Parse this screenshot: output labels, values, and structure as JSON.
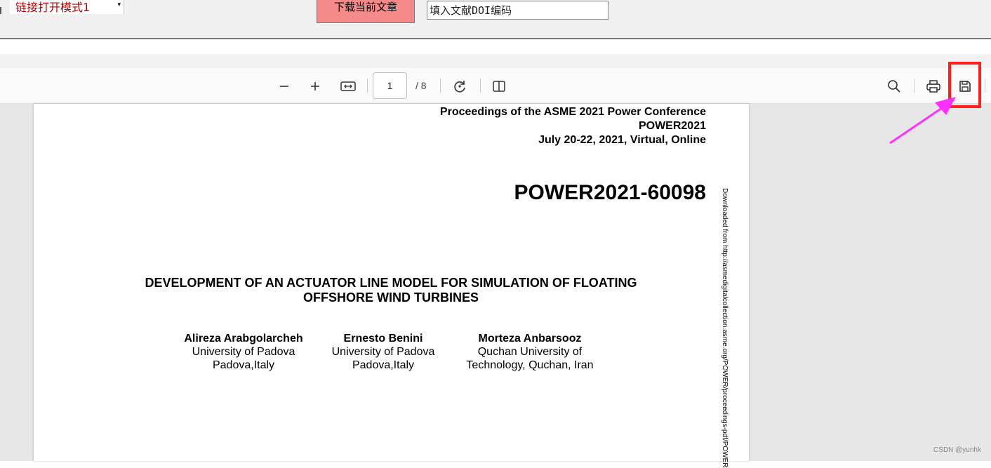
{
  "top_bar": {
    "mode_select_value": "链接打开模式1",
    "download_button_label": "下载当前文章",
    "doi_placeholder": "填入文献DOI编码"
  },
  "pdf_toolbar": {
    "page_current": "1",
    "page_total": "/ 8",
    "icons": [
      "zoom-out-icon",
      "zoom-in-icon",
      "fit-page-icon",
      "rotate-icon",
      "two-page-icon",
      "search-icon",
      "print-icon",
      "save-icon"
    ]
  },
  "document": {
    "header_lines": [
      "Proceedings of the ASME 2021 Power Conference",
      "POWER2021",
      "July 20-22, 2021, Virtual, Online"
    ],
    "paper_id": "POWER2021-60098",
    "title_lines": [
      "DEVELOPMENT OF AN ACTUATOR LINE MODEL FOR SIMULATION OF FLOATING",
      "OFFSHORE WIND TURBINES"
    ],
    "authors": [
      {
        "name": "Alireza Arabgolarcheh",
        "affil1": "University of Padova",
        "affil2": "Padova,Italy"
      },
      {
        "name": "Ernesto Benini",
        "affil1": "University of Padova",
        "affil2": "Padova,Italy"
      },
      {
        "name": "Morteza Anbarsooz",
        "affil1": "Quchan University of",
        "affil2": "Technology, Quchan, Iran"
      }
    ],
    "side_text": "Downloaded from http://asmedigitalcollection.asme.org/POWER/proceedings-pdf/POWER"
  },
  "watermark": "CSDN @yunhk",
  "colors": {
    "highlight": "#ff2020",
    "arrow": "#ff30ff",
    "download_button": "#f58a8a"
  }
}
